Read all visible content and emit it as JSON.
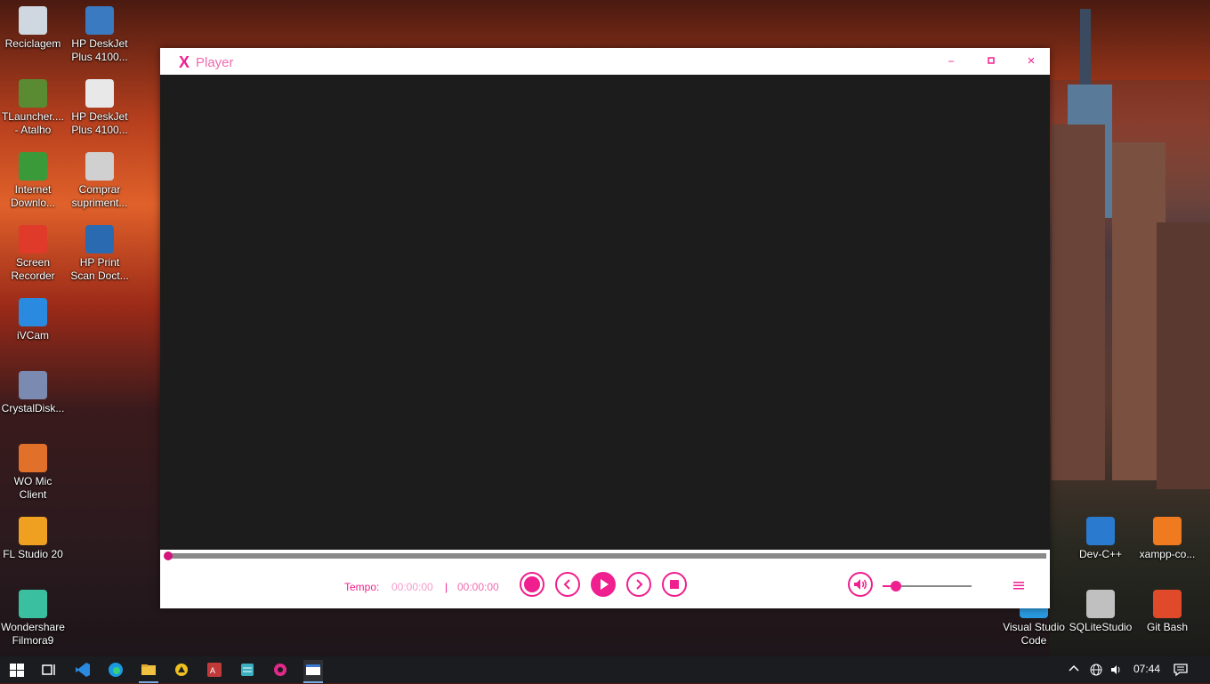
{
  "desktop": {
    "icons_left": [
      {
        "label": "Reciclagem",
        "icon": "recycle-bin-icon",
        "color": "#cfd8e0"
      },
      {
        "label": "TLauncher....\n- Atalho",
        "icon": "minecraft-icon",
        "color": "#5a8a32"
      },
      {
        "label": "Internet\nDownlo...",
        "icon": "download-manager-icon",
        "color": "#3a9a3a"
      },
      {
        "label": "Screen\nRecorder",
        "icon": "screen-recorder-icon",
        "color": "#e03a2a"
      },
      {
        "label": "iVCam",
        "icon": "webcam-icon",
        "color": "#2a8ae0"
      },
      {
        "label": "CrystalDisk...",
        "icon": "crystaldisk-icon",
        "color": "#7a8ab0"
      },
      {
        "label": "WO Mic\nClient",
        "icon": "microphone-icon",
        "color": "#e0702a"
      },
      {
        "label": "FL Studio 20",
        "icon": "fl-studio-icon",
        "color": "#f0a020"
      },
      {
        "label": "Wondershare\nFilmora9",
        "icon": "filmora-icon",
        "color": "#3ac0a0"
      }
    ],
    "icons_col2": [
      {
        "label": "HP DeskJet\nPlus 4100...",
        "icon": "scanner-icon",
        "color": "#3a7ac0"
      },
      {
        "label": "HP DeskJet\nPlus 4100...",
        "icon": "printer-icon",
        "color": "#e8e8e8"
      },
      {
        "label": "Comprar\nsupriment...",
        "icon": "printer-supplies-icon",
        "color": "#d0d0d0"
      },
      {
        "label": "HP Print\nScan Doct...",
        "icon": "print-scan-doctor-icon",
        "color": "#2a6ab0"
      }
    ],
    "icons_right": [
      {
        "label": "Dev-C++",
        "icon": "dev-cpp-icon",
        "color": "#2a7ad0"
      },
      {
        "label": "xampp-co...",
        "icon": "xampp-icon",
        "color": "#f07a20"
      },
      {
        "label": "Visual Studio\nCode",
        "icon": "vscode-icon",
        "color": "#2a9ae0"
      },
      {
        "label": "SQLiteStudio",
        "icon": "database-icon",
        "color": "#c0c0c0"
      },
      {
        "label": "Git Bash",
        "icon": "git-bash-icon",
        "color": "#e04a2a"
      }
    ]
  },
  "window": {
    "logo": "X",
    "title": "Player",
    "minimize": "−",
    "maximize": "▫",
    "close": "×",
    "accent": "#ef1f8f"
  },
  "player": {
    "seek_progress": 0,
    "time_label": "Tempo:",
    "current_time": "00:00:00",
    "separator": "|",
    "total_time": "00:00:00",
    "volume_level": 0.15
  },
  "taskbar": {
    "time": "07:44",
    "apps": [
      "start-icon",
      "task-view-icon",
      "vscode-icon",
      "edge-icon",
      "file-explorer-icon",
      "app-yellow-icon",
      "access-icon",
      "app-stack-icon",
      "app-pink-icon",
      "xplayer-icon"
    ]
  }
}
